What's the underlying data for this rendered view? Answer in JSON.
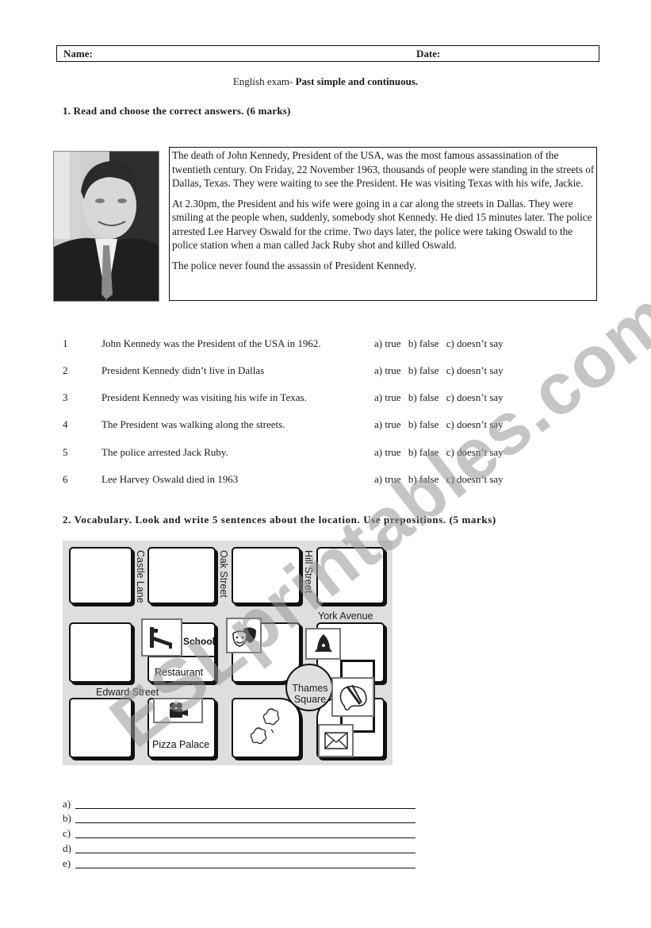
{
  "header": {
    "name_label": "Name:",
    "date_label": "Date:"
  },
  "exam_title": {
    "prefix": "English exam- ",
    "topic": "Past simple and continuous."
  },
  "section1": {
    "heading": "1. Read and choose the correct answers. (6  marks)",
    "photo_alt": "Portrait photo of John Kennedy",
    "paragraphs": [
      "The death of John Kennedy, President of the USA, was the most famous assassination of the twentieth century. On Friday, 22 November 1963, thousands of people were standing in the streets of Dallas, Texas. They were waiting to see the President. He was visiting Texas with his wife, Jackie.",
      "At 2.30pm, the President and his wife were going in a car along the streets in Dallas. They were smiling at the people when, suddenly, somebody shot Kennedy. He died 15 minutes later. The police arrested Lee Harvey Oswald for the crime. Two days later, the police were taking Oswald to the police station when a man called Jack Ruby shot and killed Oswald.",
      "The police never found the assassin of President Kennedy."
    ],
    "questions": [
      {
        "number": "1",
        "text": "John Kennedy was the President of the USA in 1962."
      },
      {
        "number": "2",
        "text": "President Kennedy didn’t live in Dallas"
      },
      {
        "number": "3",
        "text": "President Kennedy was visiting his wife in Texas."
      },
      {
        "number": "4",
        "text": "The President was walking along the streets."
      },
      {
        "number": "5",
        "text": "The police arrested Jack Ruby."
      },
      {
        "number": "6",
        "text": "Lee Harvey Oswald died in 1963"
      }
    ],
    "options": [
      "a) true",
      "b) false",
      "c) doesn’t say"
    ]
  },
  "section2": {
    "heading": "2. Vocabulary. Look and write 5 sentences about the location. Use prepositions. (5 marks)",
    "map": {
      "streets": [
        "Castle Lane",
        "Oak Street",
        "Hill Street",
        "York Avenue",
        "Edward Street",
        "Thames Square"
      ],
      "places": [
        "School",
        "Restaurant",
        "Pizza Palace"
      ],
      "icons": [
        "bed-icon",
        "theatre-masks-icon",
        "bell-icon",
        "cinema-camera-icon",
        "paint-palette-icon",
        "envelope-icon",
        "tree-icon"
      ]
    },
    "answer_labels": [
      "a)",
      "b)",
      "c)",
      "d)",
      "e)"
    ]
  },
  "watermark": "ESLprintables.com"
}
